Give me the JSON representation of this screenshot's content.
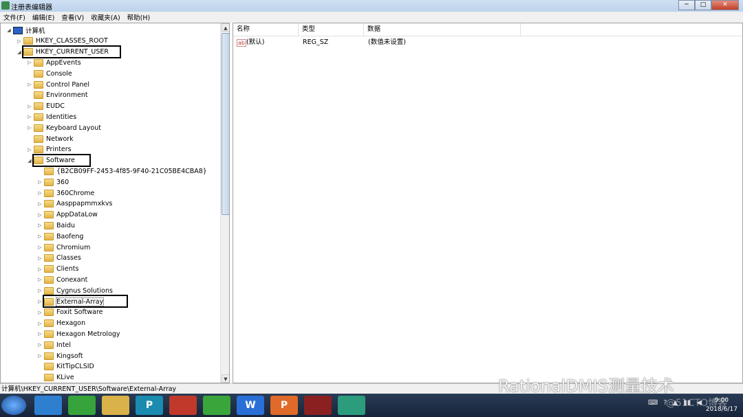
{
  "window": {
    "title": "注册表编辑器",
    "min": "─",
    "max": "□",
    "close": "✕"
  },
  "menu": [
    "文件(F)",
    "编辑(E)",
    "查看(V)",
    "收藏夹(A)",
    "帮助(H)"
  ],
  "tree": [
    {
      "label": "计算机",
      "level": 0,
      "expanded": true,
      "icon": "computer"
    },
    {
      "label": "HKEY_CLASSES_ROOT",
      "level": 1
    },
    {
      "label": "HKEY_CURRENT_USER",
      "level": 1,
      "expanded": true,
      "highlighted": true
    },
    {
      "label": "AppEvents",
      "level": 2
    },
    {
      "label": "Console",
      "level": 2,
      "leaf": true
    },
    {
      "label": "Control Panel",
      "level": 2
    },
    {
      "label": "Environment",
      "level": 2,
      "leaf": true
    },
    {
      "label": "EUDC",
      "level": 2
    },
    {
      "label": "Identities",
      "level": 2
    },
    {
      "label": "Keyboard Layout",
      "level": 2
    },
    {
      "label": "Network",
      "level": 2,
      "leaf": true
    },
    {
      "label": "Printers",
      "level": 2
    },
    {
      "label": "Software",
      "level": 2,
      "expanded": true,
      "highlighted": true
    },
    {
      "label": "{B2CB09FF-2453-4f85-9F40-21C05BE4CBA8}",
      "level": 3,
      "leaf": true
    },
    {
      "label": "360",
      "level": 3
    },
    {
      "label": "360Chrome",
      "level": 3
    },
    {
      "label": "Aasppapmmxkvs",
      "level": 3
    },
    {
      "label": "AppDataLow",
      "level": 3
    },
    {
      "label": "Baidu",
      "level": 3
    },
    {
      "label": "Baofeng",
      "level": 3
    },
    {
      "label": "Chromium",
      "level": 3
    },
    {
      "label": "Classes",
      "level": 3
    },
    {
      "label": "Clients",
      "level": 3
    },
    {
      "label": "Conexant",
      "level": 3
    },
    {
      "label": "Cygnus Solutions",
      "level": 3
    },
    {
      "label": "External-Array",
      "level": 3,
      "highlighted": true,
      "selected": true
    },
    {
      "label": "Foxit Software",
      "level": 3
    },
    {
      "label": "Hexagon",
      "level": 3
    },
    {
      "label": "Hexagon Metrology",
      "level": 3
    },
    {
      "label": "Intel",
      "level": 3
    },
    {
      "label": "Kingsoft",
      "level": 3
    },
    {
      "label": "KitTipCLSID",
      "level": 3,
      "leaf": true
    },
    {
      "label": "KLive",
      "level": 3,
      "leaf": true
    }
  ],
  "list": {
    "headers": [
      "名称",
      "类型",
      "数据"
    ],
    "rows": [
      {
        "icon": "ab",
        "name": "(默认)",
        "type": "REG_SZ",
        "data": "(数值未设置)"
      }
    ]
  },
  "status": "计算机\\HKEY_CURRENT_USER\\Software\\External-Array",
  "taskbar": {
    "apps": [
      {
        "label": "",
        "color": "#2f7fd0"
      },
      {
        "label": "",
        "color": "#36a33b"
      },
      {
        "label": "",
        "color": "#d9b24a"
      },
      {
        "label": "P",
        "color": "#1b8bb0"
      },
      {
        "label": "",
        "color": "#c0392b"
      },
      {
        "label": "",
        "color": "#3aa53a"
      },
      {
        "label": "W",
        "color": "#2a6fd6"
      },
      {
        "label": "P",
        "color": "#e06a2a"
      },
      {
        "label": "",
        "color": "#8b2020"
      },
      {
        "label": "",
        "color": "#2d9c7d"
      }
    ],
    "time": "9:00",
    "date": "2018/6/17"
  },
  "watermark": "RationalDMIS测量技术",
  "watermark2": "@51CTO博客"
}
